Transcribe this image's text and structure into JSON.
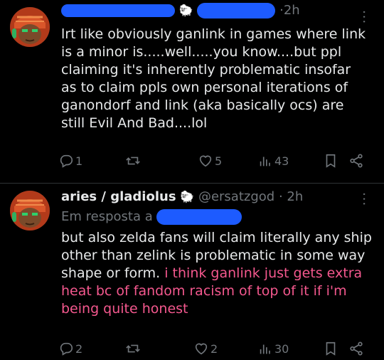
{
  "tweets": [
    {
      "name": "",
      "handle": "",
      "time": "2h",
      "emoji": "🐑",
      "lines": [
        "lrt like obviously ganlink in games where link",
        "is a minor is.....well.....you know....but ppl",
        "claiming it's inherently problematic insofar",
        "as to claim ppls own personal iterations of",
        "ganondorf and link (aka basically ocs) are",
        "still Evil And Bad....lol"
      ],
      "actions": {
        "replies": "1",
        "retweets": "",
        "likes": "5",
        "views": "43"
      }
    },
    {
      "name": "aries / gladiolus",
      "handle": "@ersatzgod",
      "time": "2h",
      "emoji": "🐑",
      "reply_prefix": "Em resposta a",
      "lines_white": [
        "but also zelda fans will claim literally any ship",
        "other than zelink is problematic in some way",
        "shape or form."
      ],
      "pink_inline": " i think ganlink just gets extra",
      "lines_pink": [
        "heat bc of fandom racism of top of it if i'm",
        "being quite honest"
      ],
      "actions": {
        "replies": "2",
        "retweets": "",
        "likes": "2",
        "views": "30"
      }
    }
  ],
  "colors": {
    "background": "#000000",
    "text": "#e7e9ea",
    "muted": "#71767b",
    "pink": "#f4588e",
    "redaction": "#1d5bff"
  },
  "icons": [
    "reply-icon",
    "retweet-icon",
    "like-icon",
    "views-icon",
    "bookmark-icon",
    "share-icon",
    "more-icon"
  ]
}
